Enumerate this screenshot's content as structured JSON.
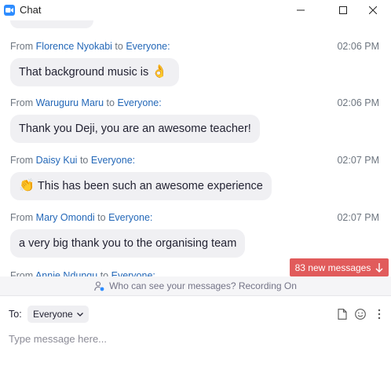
{
  "window": {
    "title": "Chat",
    "app_icon": "zoom-app-icon",
    "controls": [
      "minimize-icon",
      "maximize-icon",
      "close-icon"
    ]
  },
  "messages": [
    {
      "from_label": "From",
      "sender": "Florence Nyokabi",
      "to_label": "to",
      "recipient": "Everyone:",
      "time": "02:06 PM",
      "text_before": "That background music is",
      "emoji": "👌",
      "text_after": ""
    },
    {
      "from_label": "From",
      "sender": "Waruguru Maru",
      "to_label": "to",
      "recipient": "Everyone:",
      "time": "02:06 PM",
      "text_before": "Thank you Deji, you are an awesome teacher!",
      "emoji": "",
      "text_after": ""
    },
    {
      "from_label": "From",
      "sender": "Daisy Kui",
      "to_label": "to",
      "recipient": "Everyone:",
      "time": "02:07 PM",
      "text_before": "",
      "emoji": "👏",
      "text_after": "This has been such an awesome experience"
    },
    {
      "from_label": "From",
      "sender": "Mary Omondi",
      "to_label": "to",
      "recipient": "Everyone:",
      "time": "02:07 PM",
      "text_before": "a very big thank you to the organising team",
      "emoji": "",
      "text_after": ""
    }
  ],
  "partial_message": {
    "from_label": "From",
    "sender": "Annie Ndungu",
    "to_label": "to",
    "recipient": "Everyone:"
  },
  "new_messages_button": {
    "label": "83 new messages",
    "icon": "arrow-down-icon",
    "color": "#e15b5b"
  },
  "privacy_bar": {
    "text": "Who can see your messages? Recording On",
    "icon": "person-lock-icon"
  },
  "compose": {
    "to_label": "To:",
    "recipient": "Everyone",
    "placeholder": "Type message here...",
    "tools": [
      "file-icon",
      "emoji-icon",
      "more-icon"
    ]
  },
  "colors": {
    "link": "#2468b8",
    "bubble": "#f0f0f3",
    "accent": "#2d8cff"
  }
}
